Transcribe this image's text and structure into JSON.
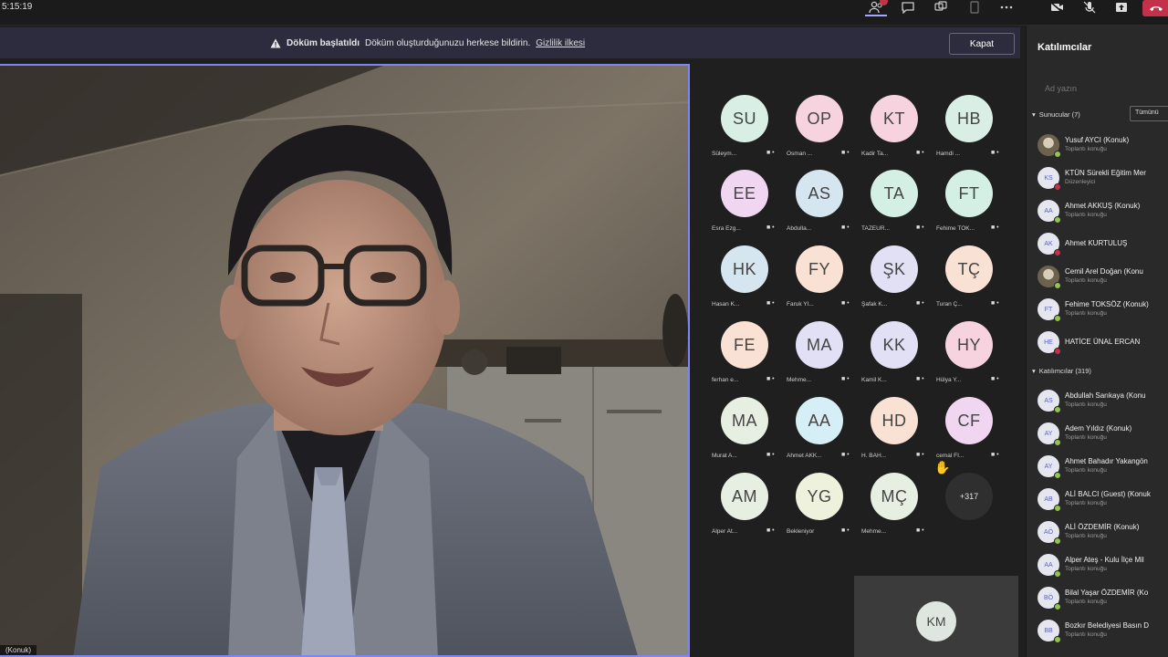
{
  "topbar": {
    "timer": "5:15:19",
    "icons": [
      "people-icon",
      "chat-icon",
      "reactions-icon",
      "share-tray-icon",
      "more-icon",
      "camera-icon",
      "mic-icon",
      "share-icon",
      "leave-icon"
    ]
  },
  "banner": {
    "title": "Döküm başlatıldı",
    "message": "Döküm oluşturduğunuzu herkese bildirin.",
    "link": "Gizlilik ilkesi",
    "close_label": "Kapat"
  },
  "main_video": {
    "name_tag": "(Konuk)"
  },
  "grid": {
    "tiles": [
      {
        "initials": "SU",
        "name": "Süleym...",
        "color": "#d9efe5"
      },
      {
        "initials": "OP",
        "name": "Osman ...",
        "color": "#f7d3e0"
      },
      {
        "initials": "KT",
        "name": "Kadir Ta...",
        "color": "#f7d3e0"
      },
      {
        "initials": "HB",
        "name": "Hamdi ...",
        "color": "#d9efe5"
      },
      {
        "initials": "EE",
        "name": "Esra Ezg...",
        "color": "#f0d6f0"
      },
      {
        "initials": "AS",
        "name": "Abdulla...",
        "color": "#d6e6f0"
      },
      {
        "initials": "TA",
        "name": "TAZEUR...",
        "color": "#d4f0e4"
      },
      {
        "initials": "FT",
        "name": "Fehime TOK...",
        "color": "#d4f0e4"
      },
      {
        "initials": "HK",
        "name": "Hasan K...",
        "color": "#d6e6f0"
      },
      {
        "initials": "FY",
        "name": "Faruk YI...",
        "color": "#f9e1d3"
      },
      {
        "initials": "ŞK",
        "name": "Şafak K...",
        "color": "#e2e0f5"
      },
      {
        "initials": "TÇ",
        "name": "Turan Ç...",
        "color": "#f9e1d3"
      },
      {
        "initials": "FE",
        "name": "ferhan e...",
        "color": "#f9e1d3"
      },
      {
        "initials": "MA",
        "name": "Mehme...",
        "color": "#e2e0f5"
      },
      {
        "initials": "KK",
        "name": "Kamil K...",
        "color": "#e2e0f5"
      },
      {
        "initials": "HY",
        "name": "Hülya Y...",
        "color": "#f7d3e0"
      },
      {
        "initials": "MA",
        "name": "Murat A...",
        "color": "#e6efe2"
      },
      {
        "initials": "AA",
        "name": "Ahmet AKK...",
        "color": "#d6eef5"
      },
      {
        "initials": "HD",
        "name": "H. BAH...",
        "color": "#f9e1d3"
      },
      {
        "initials": "CF",
        "name": "cemal FI...",
        "color": "#f0d6f0"
      },
      {
        "initials": "AM",
        "name": "Alper At...",
        "color": "#e6efe2"
      },
      {
        "initials": "YG",
        "name": "Bekleniyor",
        "color": "#eef2dc"
      },
      {
        "initials": "MÇ",
        "name": "Mehme...",
        "color": "#e6efe2"
      }
    ],
    "more_label": "+317",
    "self_initials": "KM"
  },
  "panel": {
    "title": "Katılımcılar",
    "search_placeholder": "Ad yazın",
    "presenters_header": "Sunucular (7)",
    "mute_all_label": "Tümünü",
    "presenters": [
      {
        "initials": "YA",
        "name": "Yusuf AYCI (Konuk)",
        "role": "Toplantı konuğu",
        "photo": true
      },
      {
        "initials": "KS",
        "name": "KTÜN Sürekli Eğitim Mer",
        "role": "Düzenleyici",
        "photo": false
      },
      {
        "initials": "AA",
        "name": "Ahmet AKKUŞ (Konuk)",
        "role": "Toplantı konuğu",
        "photo": false
      },
      {
        "initials": "AK",
        "name": "Ahmet KURTULUŞ",
        "role": "",
        "photo": false
      },
      {
        "initials": "CD",
        "name": "Cemil Arel Doğan (Konu",
        "role": "Toplantı konuğu",
        "photo": true
      },
      {
        "initials": "FT",
        "name": "Fehime TOKSÖZ (Konuk)",
        "role": "Toplantı konuğu",
        "photo": false
      },
      {
        "initials": "HE",
        "name": "HATİCE ÜNAL ERCAN",
        "role": "",
        "photo": false
      }
    ],
    "attendees_header": "Katılımcılar (319)",
    "attendees": [
      {
        "initials": "AS",
        "name": "Abdullah Sarıkaya (Konu",
        "role": "Toplantı konuğu"
      },
      {
        "initials": "AY",
        "name": "Adem Yıldız (Konuk)",
        "role": "Toplantı konuğu"
      },
      {
        "initials": "AY",
        "name": "Ahmet Bahadır Yakangön",
        "role": "Toplantı konuğu"
      },
      {
        "initials": "AB",
        "name": "ALİ BALCI (Guest) (Konuk",
        "role": "Toplantı konuğu"
      },
      {
        "initials": "AÖ",
        "name": "ALİ ÖZDEMİR (Konuk)",
        "role": "Toplantı konuğu"
      },
      {
        "initials": "AA",
        "name": "Alper Ateş - Kulu İlçe Mil",
        "role": "Toplantı konuğu"
      },
      {
        "initials": "BÖ",
        "name": "Bilal Yaşar ÖZDEMİR (Ko",
        "role": "Toplantı konuğu"
      },
      {
        "initials": "BB",
        "name": "Bozkır Belediyesi Basın D",
        "role": "Toplantı konuğu"
      }
    ]
  }
}
